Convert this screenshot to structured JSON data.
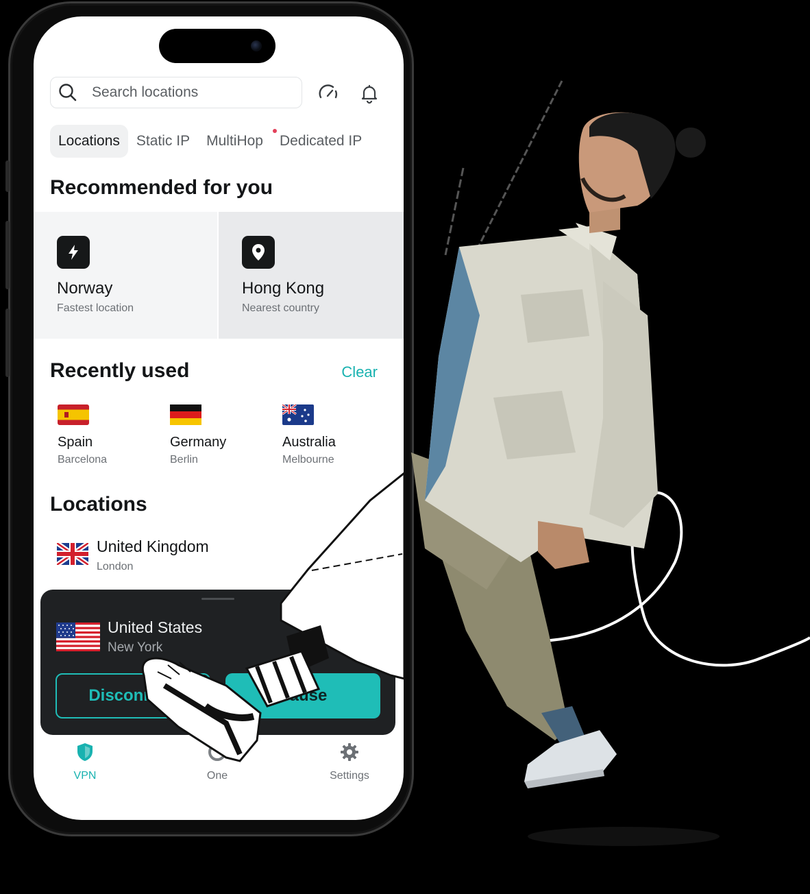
{
  "search": {
    "placeholder": "Search locations"
  },
  "tabs": [
    {
      "label": "Locations",
      "active": true
    },
    {
      "label": "Static IP",
      "active": false
    },
    {
      "label": "MultiHop",
      "active": false
    },
    {
      "label": "Dedicated IP",
      "active": false,
      "badge": true
    }
  ],
  "recommended": {
    "title": "Recommended for you",
    "items": [
      {
        "name": "Norway",
        "sub": "Fastest location",
        "icon": "bolt-icon"
      },
      {
        "name": "Hong Kong",
        "sub": "Nearest country",
        "icon": "location-pin-icon"
      }
    ]
  },
  "recent": {
    "title": "Recently used",
    "clear_label": "Clear",
    "items": [
      {
        "name": "Spain",
        "city": "Barcelona"
      },
      {
        "name": "Germany",
        "city": "Berlin"
      },
      {
        "name": "Australia",
        "city": "Melbourne"
      }
    ]
  },
  "locations": {
    "title": "Locations",
    "items": [
      {
        "name": "United Kingdom",
        "city": "London"
      }
    ]
  },
  "connection": {
    "country": "United States",
    "city": "New York",
    "disconnect_label": "Disconnect",
    "pause_label": "Pause"
  },
  "nav": [
    {
      "label": "VPN",
      "icon": "shield-icon",
      "active": true
    },
    {
      "label": "One",
      "icon": "circle-icon",
      "active": false
    },
    {
      "label": "Settings",
      "icon": "gear-icon",
      "active": false
    }
  ],
  "colors": {
    "accent": "#1fbdb7",
    "dark_card": "#1f2123",
    "badge": "#e3405a"
  }
}
